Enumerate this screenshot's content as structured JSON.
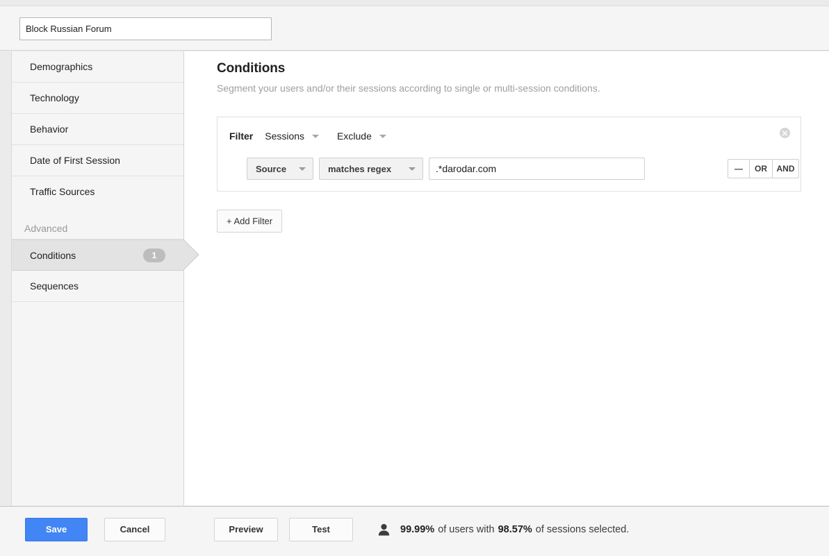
{
  "segment": {
    "name_value": "Block Russian Forum",
    "name_placeholder": "Segment Name"
  },
  "sidebar": {
    "items": [
      {
        "label": "Demographics"
      },
      {
        "label": "Technology"
      },
      {
        "label": "Behavior"
      },
      {
        "label": "Date of First Session"
      },
      {
        "label": "Traffic Sources"
      }
    ],
    "group_label": "Advanced",
    "advanced_items": [
      {
        "label": "Conditions",
        "badge": "1",
        "selected": true
      },
      {
        "label": "Sequences",
        "badge": "",
        "selected": false
      }
    ]
  },
  "main": {
    "title": "Conditions",
    "subtitle": "Segment your users and/or their sessions according to single or multi-session conditions.",
    "filter": {
      "label": "Filter",
      "scope_value": "Sessions",
      "mode_value": "Exclude",
      "dimension_value": "Source",
      "operator_value": "matches regex",
      "value_text": ".*darodar.com",
      "value_placeholder": "Value",
      "remove_label": "—",
      "or_label": "OR",
      "and_label": "AND",
      "close_icon": "close-circle-icon"
    },
    "add_filter_label": "+ Add Filter"
  },
  "footer": {
    "save_label": "Save",
    "cancel_label": "Cancel",
    "preview_label": "Preview",
    "test_label": "Test",
    "user_icon": "person-icon",
    "stats": {
      "users_percent": "99.99%",
      "mid_text": "of users with",
      "sessions_percent": "98.57%",
      "tail_text": "of sessions selected."
    }
  },
  "colors": {
    "accent": "#4285f4",
    "panel_bg": "#f5f5f5",
    "badge_bg": "#bdbdbd"
  }
}
